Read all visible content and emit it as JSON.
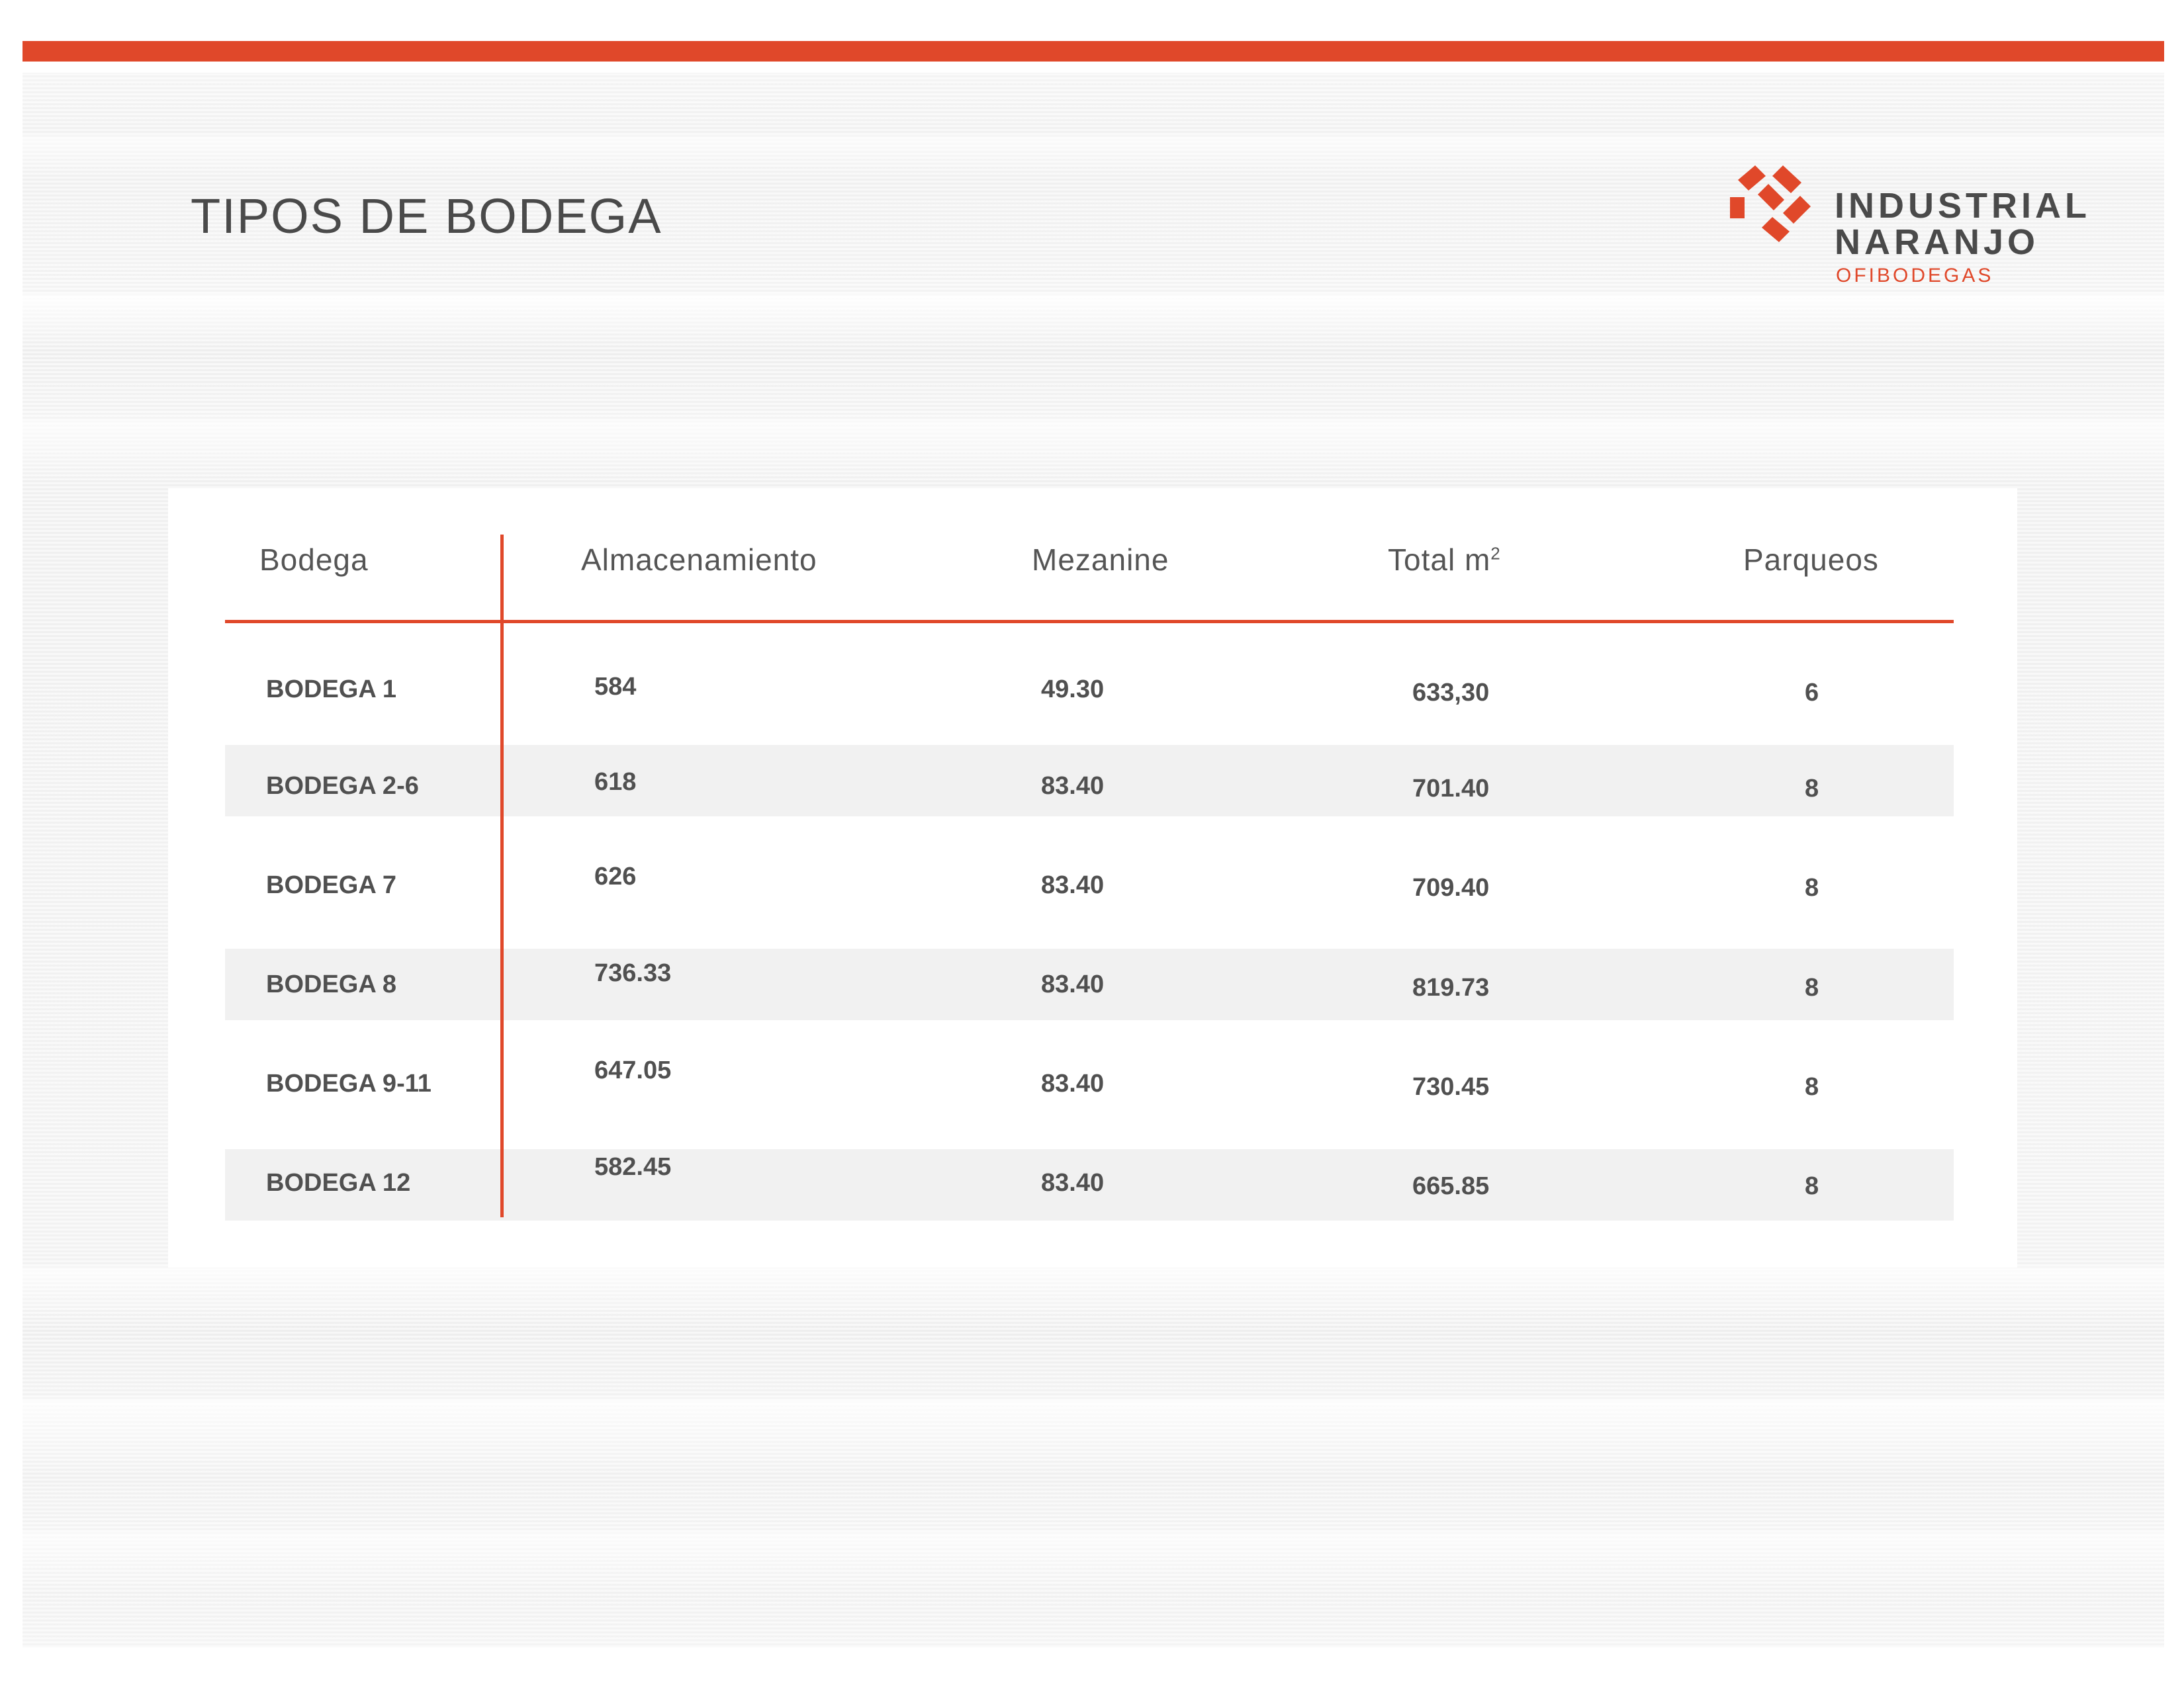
{
  "page_title": "TIPOS DE BODEGA",
  "brand": {
    "line1": "INDUSTRIAL",
    "line2": "NARANJO",
    "line3": "OFIBODEGAS",
    "accent_color": "#e0482a",
    "text_color": "#4a4a4a"
  },
  "table": {
    "headers": {
      "bodega": "Bodega",
      "almacenamiento": "Almacenamiento",
      "mezanine": "Mezanine",
      "total": "Total m",
      "total_sup": "2",
      "parqueos": "Parqueos"
    },
    "rows": [
      {
        "bodega": "BODEGA 1",
        "almacenamiento": "584",
        "mezanine": "49.30",
        "total": "633,30",
        "parqueos": "6"
      },
      {
        "bodega": "BODEGA 2-6",
        "almacenamiento": "618",
        "mezanine": "83.40",
        "total": "701.40",
        "parqueos": "8"
      },
      {
        "bodega": "BODEGA 7",
        "almacenamiento": "626",
        "mezanine": "83.40",
        "total": "709.40",
        "parqueos": "8"
      },
      {
        "bodega": "BODEGA 8",
        "almacenamiento": "736.33",
        "mezanine": "83.40",
        "total": "819.73",
        "parqueos": "8"
      },
      {
        "bodega": "BODEGA 9-11",
        "almacenamiento": "647.05",
        "mezanine": "83.40",
        "total": "730.45",
        "parqueos": "8"
      },
      {
        "bodega": "BODEGA 12",
        "almacenamiento": "582.45",
        "mezanine": "83.40",
        "total": "665.85",
        "parqueos": "8"
      }
    ]
  }
}
